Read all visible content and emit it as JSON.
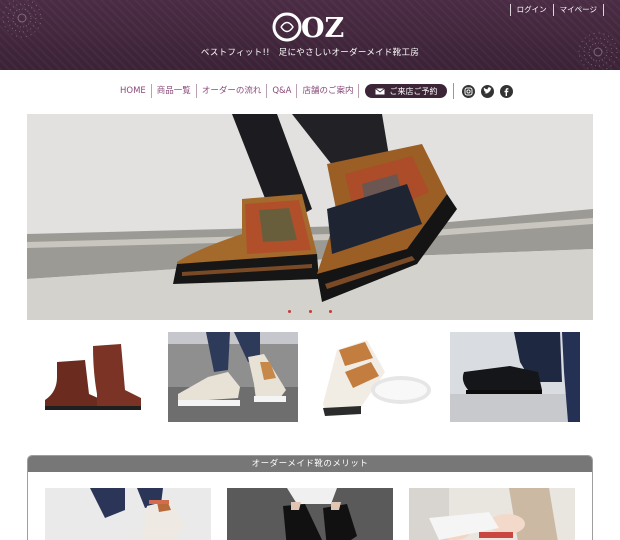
{
  "header": {
    "logo_text": "OZ",
    "tagline": "ベストフィット!!　足にやさしいオーダーメイド靴工房",
    "top_links": [
      "ログイン",
      "マイページ"
    ]
  },
  "nav": {
    "items": [
      "HOME",
      "商品一覧",
      "オーダーの流れ",
      "Q&A",
      "店舗のご案内"
    ],
    "visit_button": "ご来店ご予約"
  },
  "social": [
    "instagram",
    "twitter",
    "facebook"
  ],
  "hero": {
    "slide_count": 3
  },
  "merit": {
    "title": "オーダーメイド靴のメリット"
  },
  "colors": {
    "brand_purple": "#3d2538",
    "nav_text": "#8a4a7a",
    "section_header": "#777777"
  }
}
